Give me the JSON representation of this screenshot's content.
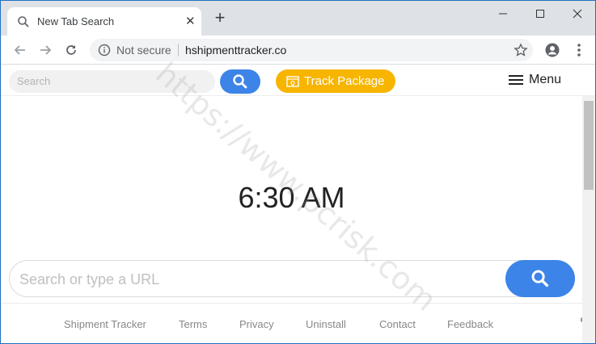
{
  "browser": {
    "tab_title": "New Tab Search",
    "tab_close": "✕",
    "new_tab": "+",
    "not_secure": "Not secure",
    "url": "hshipmenttracker.co"
  },
  "header": {
    "search_placeholder": "Search",
    "track_label": "Track Package",
    "menu_label": "Menu"
  },
  "main": {
    "clock": "6:30 AM",
    "search_placeholder": "Search or type a URL"
  },
  "footer": {
    "links": [
      "Shipment Tracker",
      "Terms",
      "Privacy",
      "Uninstall",
      "Contact",
      "Feedback"
    ]
  },
  "watermark": "https://www.pcrisk.com",
  "colors": {
    "search_blue": "#3d84e8",
    "track_yellow": "#f7b500"
  }
}
